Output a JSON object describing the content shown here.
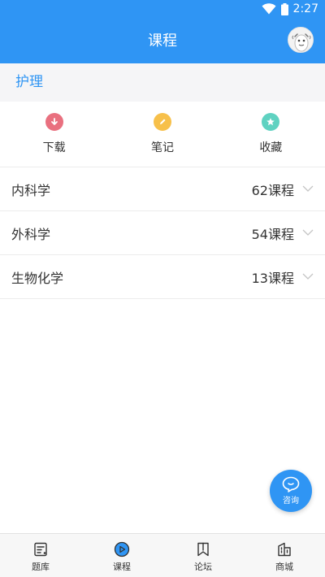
{
  "status_bar": {
    "time": "2:27",
    "icons": [
      "wifi-icon",
      "battery-icon"
    ]
  },
  "header": {
    "title": "课程",
    "avatar_icon": "avatar-icon"
  },
  "section": {
    "title": "护理"
  },
  "actions": [
    {
      "label": "下载",
      "icon": "download-icon",
      "color": "#e9707f"
    },
    {
      "label": "笔记",
      "icon": "pencil-icon",
      "color": "#f7c04a"
    },
    {
      "label": "收藏",
      "icon": "star-icon",
      "color": "#5fd2c1"
    }
  ],
  "subjects": [
    {
      "name": "内科学",
      "count": "62课程"
    },
    {
      "name": "外科学",
      "count": "54课程"
    },
    {
      "name": "生物化学",
      "count": "13课程"
    }
  ],
  "consult_button": {
    "label": "咨询",
    "icon": "chat-bubble-icon"
  },
  "tabs": [
    {
      "label": "题库",
      "icon": "question-bank-icon",
      "active": false
    },
    {
      "label": "课程",
      "icon": "play-circle-icon",
      "active": true
    },
    {
      "label": "论坛",
      "icon": "forum-icon",
      "active": false
    },
    {
      "label": "商城",
      "icon": "shop-icon",
      "active": false
    }
  ],
  "colors": {
    "primary": "#2f95f4",
    "section_bg": "#f5f5f7",
    "divider": "#ececec"
  }
}
